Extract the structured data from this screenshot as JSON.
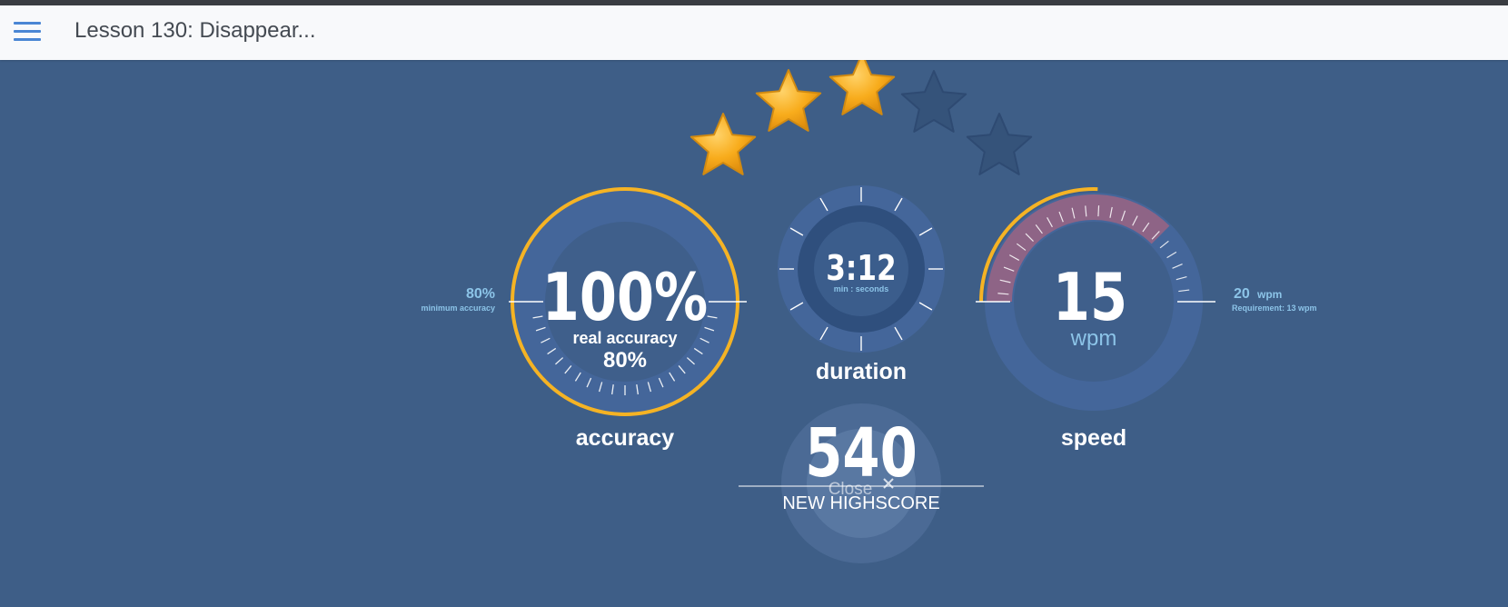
{
  "topbar": {
    "menu_icon": "hamburger-menu-icon",
    "title": "Lesson 130: Disappear..."
  },
  "stars": {
    "earned": 3,
    "total": 5,
    "earned_color": "#f7a81b",
    "empty_color": "#35537a"
  },
  "accuracy": {
    "value": "100%",
    "real_label": "real accuracy",
    "real_value": "80%",
    "label": "accuracy",
    "min_value": "80%",
    "min_label": "minimum accuracy",
    "fill_fraction": 1.0
  },
  "duration": {
    "value": "3:12",
    "unit_label": "min : seconds",
    "label": "duration"
  },
  "speed": {
    "value": "15",
    "unit": "wpm",
    "label": "speed",
    "req_value": "20",
    "req_unit": "wpm",
    "req_label": "Requirement: 13 wpm"
  },
  "score": {
    "value": "540",
    "close_label": "Close",
    "highscore_label": "NEW HIGHSCORE"
  },
  "colors": {
    "background": "#3e5e87",
    "ring": "#44669a",
    "accent_gold": "#f5b324",
    "speed_band": "#8e6486",
    "label_blue": "#8cc4e8"
  }
}
